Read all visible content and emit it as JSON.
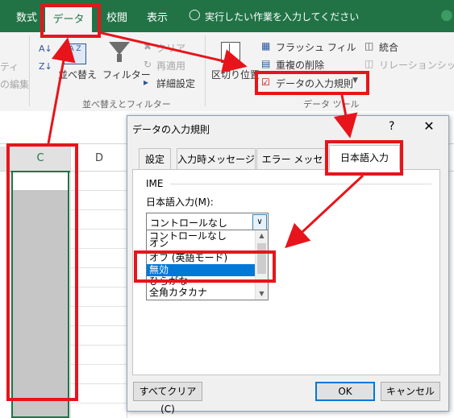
{
  "ribbon": {
    "tabs": [
      "数式",
      "データ",
      "校閲",
      "表示"
    ],
    "active_tab": "データ",
    "tell_me": "実行したい作業を入力してください",
    "left_cut_1": "ティ",
    "left_cut_2": "の編集",
    "sort_label": "並べ替え",
    "sort_az": "A Z",
    "filter_label": "フィルター",
    "clear_label": "クリア",
    "reapply_label": "再適用",
    "advanced_label": "詳細設定",
    "group_sort_filter": "並べ替えとフィルター",
    "text_to_columns": "区切り位置",
    "flash_fill": "フラッシュ フィル",
    "remove_duplicates": "重複の削除",
    "data_validation": "データの入力規則",
    "group_data_tools": "データ ツール",
    "consolidate": "統合",
    "relationships": "リレーションシップ"
  },
  "sheet": {
    "columns": [
      "C",
      "D"
    ]
  },
  "dialog": {
    "title": "データの入力規則",
    "help": "?",
    "close": "✕",
    "tabs": [
      "設定",
      "入力時メッセージ",
      "エラー メッセージ",
      "日本語入力"
    ],
    "active_tab": "日本語入力",
    "group_label": "IME",
    "mode_label": "日本語入力(M):",
    "combo_value": "コントロールなし",
    "options": [
      "コントロールなし",
      "オン",
      "オフ (英語モード)",
      "無効",
      "ひらがな",
      "全角カタカナ"
    ],
    "selected_option": "無効",
    "clear_all": "すべてクリア(C)",
    "ok": "OK",
    "cancel": "キャンセル"
  },
  "colors": {
    "excel_green": "#217346",
    "annotation_red": "#e8141b",
    "selection_blue": "#0078d7"
  }
}
